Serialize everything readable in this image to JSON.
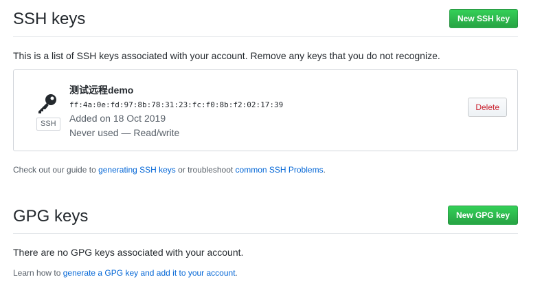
{
  "ssh": {
    "title": "SSH keys",
    "new_button": "New SSH key",
    "description": "This is a list of SSH keys associated with your account. Remove any keys that you do not recognize.",
    "key": {
      "badge": "SSH",
      "title": "测试远程demo",
      "fingerprint": "ff:4a:0e:fd:97:8b:78:31:23:fc:f0:8b:f2:02:17:39",
      "added": "Added on 18 Oct 2019",
      "usage": "Never used — Read/write",
      "delete_label": "Delete"
    },
    "note": {
      "prefix": "Check out our guide to ",
      "link1": "generating SSH keys",
      "middle": " or troubleshoot ",
      "link2": "common SSH Problems",
      "suffix": "."
    }
  },
  "gpg": {
    "title": "GPG keys",
    "new_button": "New GPG key",
    "description": "There are no GPG keys associated with your account.",
    "note": {
      "prefix": "Learn how to ",
      "link": "generate a GPG key and add it to your account",
      "suffix": "."
    }
  },
  "colors": {
    "accent_green": "#28a745",
    "link": "#0366d6",
    "danger": "#cb2431"
  }
}
